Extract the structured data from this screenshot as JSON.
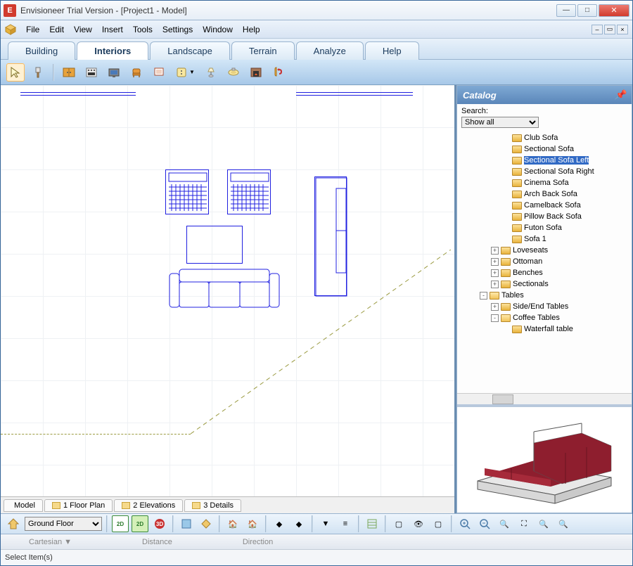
{
  "window": {
    "title": "Envisioneer Trial Version - [Project1 - Model]"
  },
  "menu": {
    "items": [
      "File",
      "Edit",
      "View",
      "Insert",
      "Tools",
      "Settings",
      "Window",
      "Help"
    ]
  },
  "tabs": {
    "items": [
      "Building",
      "Interiors",
      "Landscape",
      "Terrain",
      "Analyze",
      "Help"
    ],
    "active": 1
  },
  "toolbar": {
    "items": [
      {
        "name": "pointer",
        "active": true
      },
      {
        "name": "paint-brush"
      },
      {
        "sep": true
      },
      {
        "name": "cabinet"
      },
      {
        "name": "appliance"
      },
      {
        "name": "electronics"
      },
      {
        "name": "furniture-chair"
      },
      {
        "name": "interior-accessory"
      },
      {
        "name": "electrical-outlet",
        "drop": true
      },
      {
        "name": "lighting-lamp"
      },
      {
        "name": "plumbing-fixture"
      },
      {
        "name": "fireplace"
      },
      {
        "name": "mirror-tool"
      }
    ]
  },
  "viewtabs": {
    "items": [
      "Model",
      "1 Floor Plan",
      "2 Elevations",
      "3 Details"
    ]
  },
  "catalog": {
    "title": "Catalog",
    "search_label": "Search:",
    "filter": "Show all",
    "tree": [
      {
        "depth": 4,
        "icon": "item",
        "label": "Club Sofa"
      },
      {
        "depth": 4,
        "icon": "item",
        "label": "Sectional Sofa"
      },
      {
        "depth": 4,
        "icon": "item",
        "label": "Sectional Sofa Left",
        "sel": true
      },
      {
        "depth": 4,
        "icon": "item",
        "label": "Sectional Sofa Right"
      },
      {
        "depth": 4,
        "icon": "item",
        "label": "Cinema Sofa"
      },
      {
        "depth": 4,
        "icon": "item",
        "label": "Arch Back Sofa"
      },
      {
        "depth": 4,
        "icon": "item",
        "label": "Camelback Sofa"
      },
      {
        "depth": 4,
        "icon": "item",
        "label": "Pillow Back Sofa"
      },
      {
        "depth": 4,
        "icon": "item",
        "label": "Futon Sofa"
      },
      {
        "depth": 4,
        "icon": "item",
        "label": "Sofa 1"
      },
      {
        "depth": 3,
        "exp": "+",
        "icon": "folder",
        "label": "Loveseats"
      },
      {
        "depth": 3,
        "exp": "+",
        "icon": "folder",
        "label": "Ottoman"
      },
      {
        "depth": 3,
        "exp": "+",
        "icon": "folder",
        "label": "Benches"
      },
      {
        "depth": 3,
        "exp": "+",
        "icon": "folder",
        "label": "Sectionals"
      },
      {
        "depth": 2,
        "exp": "-",
        "icon": "folder-open",
        "label": "Tables"
      },
      {
        "depth": 3,
        "exp": "+",
        "icon": "folder",
        "label": "Side/End Tables"
      },
      {
        "depth": 3,
        "exp": "-",
        "icon": "folder-open",
        "label": "Coffee Tables"
      },
      {
        "depth": 4,
        "icon": "item",
        "label": "Waterfall table"
      }
    ]
  },
  "lowerbar": {
    "floor": "Ground Floor"
  },
  "coordbar": {
    "items": [
      "Cartesian ▼",
      "Distance",
      "Direction"
    ]
  },
  "status": {
    "text": "Select Item(s)"
  }
}
